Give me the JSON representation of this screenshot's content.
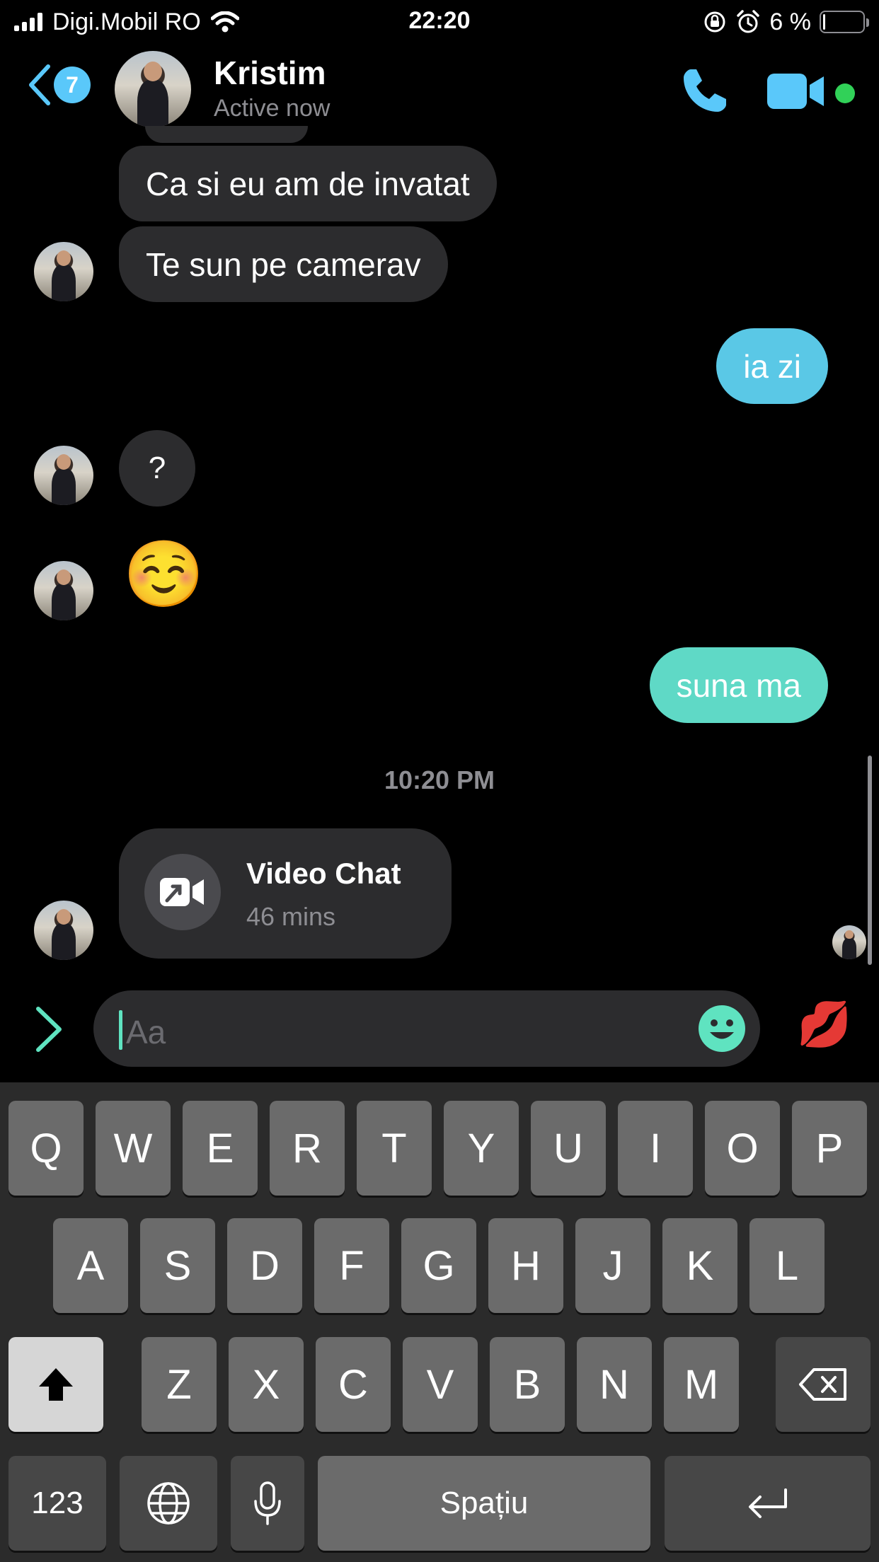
{
  "status_bar": {
    "carrier": "Digi.Mobil RO",
    "time": "22:20",
    "battery_percent": "6 %",
    "battery_level": 0.06
  },
  "header": {
    "back_badge": "7",
    "contact_name": "Kristim",
    "contact_status": "Active now"
  },
  "messages": {
    "in_1": "Ca si eu am de invatat",
    "in_2": "Te sun pe camerav",
    "out_1": "ia zi",
    "in_3": "?",
    "in_4": "☺️",
    "out_2": "suna ma"
  },
  "timestamp": "10:20 PM",
  "video_call": {
    "title": "Video Chat",
    "duration": "46 mins"
  },
  "composer": {
    "placeholder": "Aa",
    "kiss_emoji": "💋"
  },
  "keyboard": {
    "row1": [
      "Q",
      "W",
      "E",
      "R",
      "T",
      "Y",
      "U",
      "I",
      "O",
      "P"
    ],
    "row2": [
      "A",
      "S",
      "D",
      "F",
      "G",
      "H",
      "J",
      "K",
      "L"
    ],
    "row3": [
      "Z",
      "X",
      "C",
      "V",
      "B",
      "N",
      "M"
    ],
    "numbers_key": "123",
    "space_key": "Spațiu"
  },
  "colors": {
    "accent_blue": "#5ac8fa",
    "outgoing_bubble_1": "#5ac8e6",
    "outgoing_bubble_2": "#5fd9c6",
    "incoming_bubble": "#2c2c2e",
    "online_green": "#31d158"
  }
}
